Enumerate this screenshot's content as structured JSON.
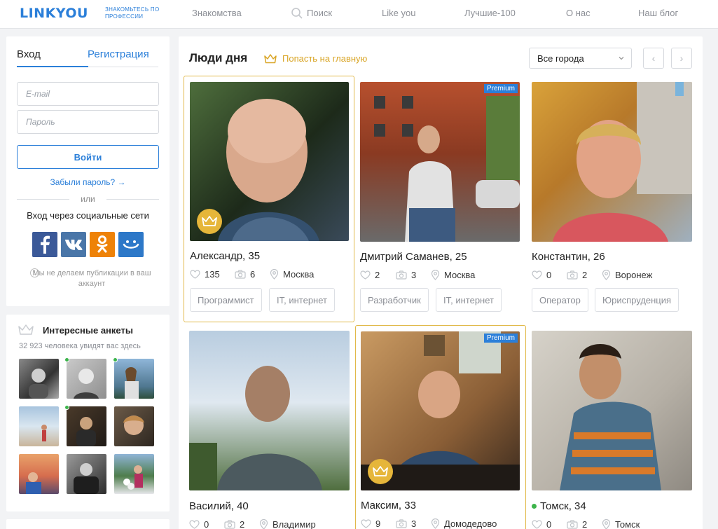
{
  "header": {
    "logo": "LINKYOU",
    "logo_tagline": "ЗНАКОМЬТЕСЬ ПО ПРОФЕССИИ",
    "nav": [
      "Знакомства",
      "Поиск",
      "Like you",
      "Лучшие-100",
      "О нас",
      "Наш блог"
    ]
  },
  "login": {
    "tab_login": "Вход",
    "tab_register": "Регистрация",
    "email_placeholder": "E-mail",
    "password_placeholder": "Пароль",
    "submit": "Войти",
    "forgot": "Забыли пароль? →",
    "or": "или",
    "social_title": "Вход через социальные сети",
    "social": [
      "facebook-icon",
      "vk-icon",
      "odnoklassniki-icon",
      "mailru-icon"
    ],
    "disclaimer": "Мы не делаем публикации в ваш аккаунт"
  },
  "interesting": {
    "title": "Интересные анкеты",
    "subtitle": "32 923 человека увидят вас здесь",
    "thumb_count": 9
  },
  "main": {
    "title": "Люди дня",
    "promo_link": "Попасть на главную",
    "city_select": "Все города",
    "pager_prev": "‹",
    "pager_next": "›",
    "cards": [
      {
        "name": "Александр, 35",
        "likes": "135",
        "photos": "6",
        "city": "Москва",
        "tags": [
          "Программист",
          "IT, интернет"
        ],
        "premium": false,
        "crown": true,
        "featured": true,
        "online": false
      },
      {
        "name": "Дмитрий Саманев, 25",
        "likes": "2",
        "photos": "3",
        "city": "Москва",
        "tags": [
          "Разработчик",
          "IT, интернет"
        ],
        "premium": true,
        "crown": false,
        "featured": false,
        "online": false
      },
      {
        "name": "Константин, 26",
        "likes": "0",
        "photos": "2",
        "city": "Воронеж",
        "tags": [
          "Оператор",
          "Юриспруденция"
        ],
        "premium": false,
        "crown": false,
        "featured": false,
        "online": false
      },
      {
        "name": "Василий, 40",
        "likes": "0",
        "photos": "2",
        "city": "Владимир",
        "tags": [],
        "premium": false,
        "crown": false,
        "featured": false,
        "online": false
      },
      {
        "name": "Максим, 33",
        "likes": "9",
        "photos": "3",
        "city": "Домодедово",
        "tags": [],
        "premium": true,
        "crown": true,
        "featured": true,
        "online": false
      },
      {
        "name": "Томск, 34",
        "likes": "0",
        "photos": "2",
        "city": "Томск",
        "tags": [],
        "premium": false,
        "crown": false,
        "featured": false,
        "online": true
      }
    ],
    "premium_label": "Premium"
  },
  "colors": {
    "accent": "#2b7fd9",
    "gold": "#e6b63a",
    "online": "#3cb44b",
    "facebook": "#3b5998",
    "vk": "#4a76a8",
    "ok": "#ee8208",
    "mailru": "#2d78c8"
  }
}
